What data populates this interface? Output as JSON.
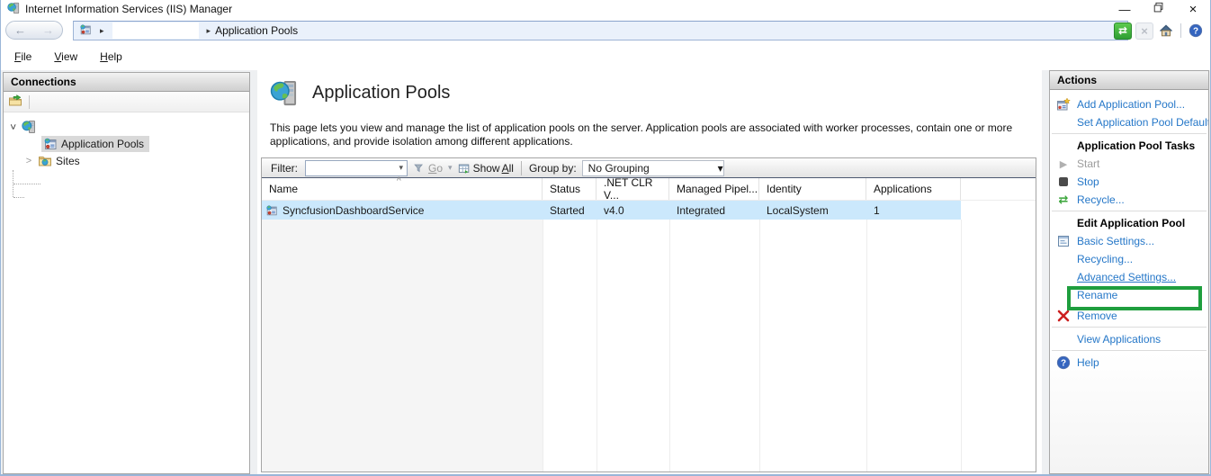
{
  "colors": {
    "action_link_blue": "#2577c8",
    "row_selection": "#cbe8fc",
    "tree_selection": "#d9d9d9",
    "annotation_green": "#1f9e3e",
    "address_bar_bg": "#eaf1fb"
  },
  "icons": {
    "back": "←",
    "forward": "→",
    "breadcrumb_arrow": "▸",
    "dropdown_arrow": "▾",
    "refresh": "⇄",
    "stop_disabled": "×",
    "minimize": "—",
    "close": "×",
    "tree_expanded_chevron": ">",
    "tree_collapsed_chevron": ">",
    "sort_ascending": "^",
    "start_glyph": "▶",
    "recycle_glyph": "⇄"
  },
  "titlebar": {
    "title": "Internet Information Services (IIS) Manager"
  },
  "breadcrumb": {
    "current": "Application Pools"
  },
  "menubar": {
    "file": "File",
    "view": "View",
    "help": "Help"
  },
  "connections": {
    "header": "Connections",
    "tree": {
      "application_pools": "Application Pools",
      "sites": "Sites"
    }
  },
  "main": {
    "title": "Application Pools",
    "description": "This page lets you view and manage the list of application pools on the server. Application pools are associated with worker processes, contain one or more applications, and provide isolation among different applications.",
    "filter_bar": {
      "filter_label": "Filter:",
      "go": "Go",
      "show_all_word1": "Show",
      "show_all_word2": "All",
      "group_by_label": "Group by:",
      "group_by_value": "No Grouping"
    },
    "table": {
      "columns": [
        "Name",
        "Status",
        ".NET CLR V...",
        "Managed Pipel...",
        "Identity",
        "Applications"
      ],
      "rows": [
        {
          "name": "SyncfusionDashboardService",
          "status": "Started",
          "clr_version": "v4.0",
          "pipeline": "Integrated",
          "identity": "LocalSystem",
          "applications": "1"
        }
      ]
    }
  },
  "actions": {
    "header": "Actions",
    "add": "Add Application Pool...",
    "set_defaults": "Set Application Pool Default",
    "tasks_title": "Application Pool Tasks",
    "start": "Start",
    "stop": "Stop",
    "recycle": "Recycle...",
    "edit_title": "Edit Application Pool",
    "basic_settings": "Basic Settings...",
    "recycling": "Recycling...",
    "advanced_settings": "Advanced Settings...",
    "rename": "Rename",
    "remove": "Remove",
    "view_applications": "View Applications",
    "help": "Help"
  }
}
